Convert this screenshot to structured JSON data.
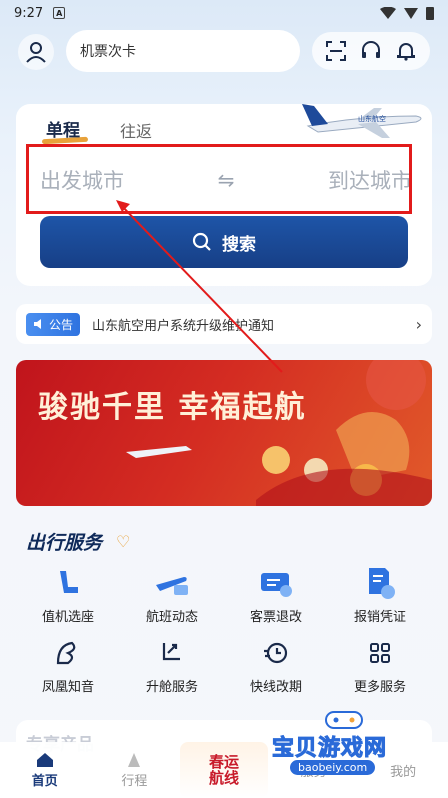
{
  "status_bar": {
    "time": "9:27",
    "notification_letter": "A"
  },
  "header": {
    "search_text": "机票次卡"
  },
  "booking": {
    "tab_single": "单程",
    "tab_round": "往返",
    "from_city": "出发城市",
    "to_city": "到达城市",
    "swap_symbol": "⇋",
    "search_label": "搜索"
  },
  "notice": {
    "badge": "公告",
    "text": "山东航空用户系统升级维护通知"
  },
  "banner": {
    "title": "骏驰千里 幸福起航"
  },
  "services": {
    "title": "出行服务",
    "items": [
      {
        "label": "值机选座",
        "icon": "seat-icon"
      },
      {
        "label": "航班动态",
        "icon": "flight-status-icon"
      },
      {
        "label": "客票退改",
        "icon": "ticket-change-icon"
      },
      {
        "label": "报销凭证",
        "icon": "receipt-icon"
      },
      {
        "label": "凤凰知音",
        "icon": "phoenix-icon"
      },
      {
        "label": "升舱服务",
        "icon": "upgrade-icon"
      },
      {
        "label": "快线改期",
        "icon": "reschedule-icon"
      },
      {
        "label": "更多服务",
        "icon": "more-icon"
      }
    ]
  },
  "exclusive": {
    "title": "专享产品"
  },
  "bottom_nav": {
    "home": "首页",
    "trip": "行程",
    "center_badge_line1": "春运",
    "center_badge_line2": "航线",
    "service": "服务",
    "mine": "我的"
  },
  "watermark": {
    "text": "宝贝游戏网",
    "url": "baobeiy.com"
  },
  "colors": {
    "primary": "#1e55a8",
    "accent": "#e8a23a",
    "banner_red": "#c0141c",
    "annotation_red": "#e21b1b"
  }
}
